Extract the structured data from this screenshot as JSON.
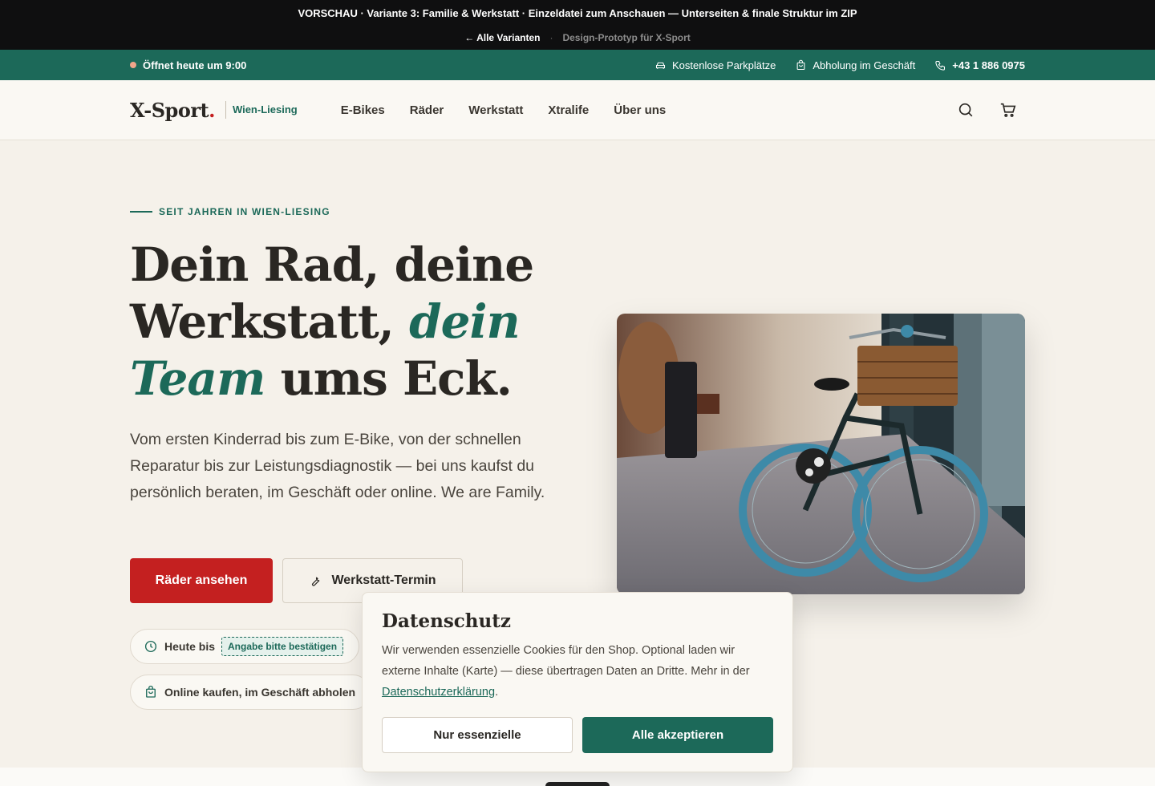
{
  "preview": {
    "title": "VORSCHAU · Variante 3: Familie & Werkstatt · Einzeldatei zum Anschauen — Unterseiten & finale Struktur im ZIP",
    "back_link": "← Alle Varianten",
    "separator": "·",
    "prototype_label": "Design-Prototyp für X-Sport"
  },
  "info_bar": {
    "opening": "Öffnet heute um 9:00",
    "parking": "Kostenlose Parkplätze",
    "pickup": "Abholung im Geschäft",
    "phone": "+43 1 886 0975",
    "icons": [
      "car-icon",
      "bag-icon",
      "phone-icon"
    ]
  },
  "nav": {
    "logo": "X-Sport",
    "logo_dot": ".",
    "location": "Wien-Liesing",
    "items": [
      "E-Bikes",
      "Räder",
      "Werkstatt",
      "Xtralife",
      "Über uns"
    ],
    "icons": [
      "search-icon",
      "cart-icon"
    ]
  },
  "hero": {
    "eyebrow": "SEIT JAHREN IN WIEN-LIESING",
    "headline_part1": "Dein Rad, deine Werkstatt,",
    "headline_accent": "dein Team",
    "headline_part2": "ums Eck.",
    "lead": "Vom ersten Kinderrad bis zum E-Bike, von der schnellen Reparatur bis zur Leistungsdiagnostik — bei uns kaufst du persönlich beraten, im Geschäft oder online. We are Family.",
    "primary_button": "Räder ansehen",
    "secondary_button": "Werkstatt-Termin",
    "hours_label": "Heute bis",
    "hours_badge": "Angabe bitte bestätigen",
    "pickup_label": "Online kaufen, im Geschäft abholen"
  },
  "cookie": {
    "title": "Datenschutz",
    "text": "Wir verwenden essenzielle Cookies für den Shop. Optional laden wir externe Inhalte (Karte) — diese übertragen Daten an Dritte. Mehr in der",
    "link": "Datenschutzerklärung",
    "text_end": ".",
    "essential_button": "Nur essenzielle",
    "accept_button": "Alle akzeptieren"
  },
  "colors": {
    "brand_green": "#1c6959",
    "brand_red": "#c42020",
    "background": "#f5f1ea"
  }
}
